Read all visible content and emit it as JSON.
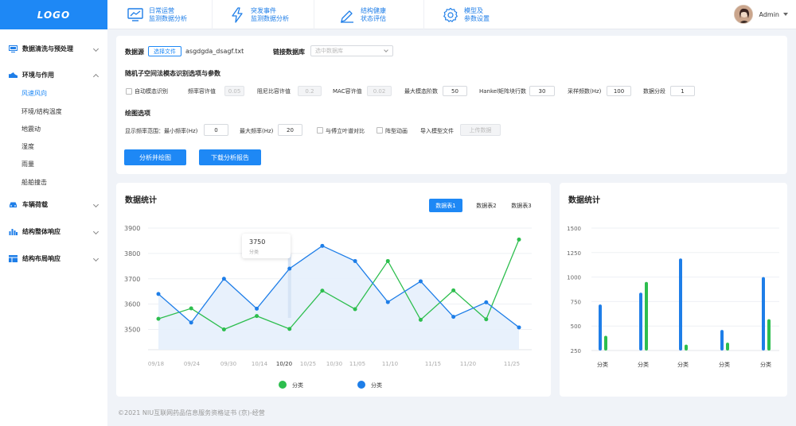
{
  "logo": "LOGO",
  "top_nav": [
    {
      "label": "日常运营\n监测数据分析",
      "icon": "monitor-chart-icon"
    },
    {
      "label": "突发事件\n监测数据分析",
      "icon": "lightning-icon"
    },
    {
      "label": "结构健康\n状态评估",
      "icon": "pen-edit-icon"
    },
    {
      "label": "模型及\n参数设置",
      "icon": "gear-icon"
    }
  ],
  "user": {
    "name": "Admin"
  },
  "sidebar": {
    "groups": [
      {
        "label": "数据清洗与预处理",
        "icon": "monitor-icon"
      },
      {
        "label": "环境与作用",
        "icon": "shoe-icon"
      },
      {
        "label": "车辆荷载",
        "icon": "car-icon"
      },
      {
        "label": "结构整体响应",
        "icon": "bar-chart-icon"
      },
      {
        "label": "结构布局响应",
        "icon": "table-layout-icon"
      }
    ],
    "sub_items": [
      "风速风向",
      "环境/结构温度",
      "地震动",
      "湿度",
      "雨量",
      "船舶撞击"
    ],
    "active_sub": "风速风向"
  },
  "form": {
    "datasource_label": "数据源",
    "choose_file": "选择文件",
    "file_name": "asgdgda_dsagf.txt",
    "link_db_label": "链接数据库",
    "db_placeholder": "选中数据库",
    "section1_title": "随机子空间法模态识别选项与参数",
    "auto_modal": "自动模态识别",
    "freq_tol_label": "频率容许值",
    "freq_tol": "0.05",
    "damp_tol_label": "阻尼比容许值",
    "damp_tol": "0.2",
    "mac_tol_label": "MAC容许值",
    "mac_tol": "0.02",
    "max_order_label": "最大模态阶数",
    "max_order": "50",
    "hankel_label": "Hankel矩阵块行数",
    "hankel": "30",
    "sample_label": "采样频数(Hz)",
    "sample": "100",
    "segments_label": "数据分段",
    "segments": "1",
    "section2_title": "绘图选项",
    "freq_range_label": "显示频率范围：最小频率(Hz)",
    "min_freq": "0",
    "max_freq_label": "最大频率(Hz)",
    "max_freq": "20",
    "fourier_label": "与傅立叶谱对比",
    "mode_anim_label": "阵型动画",
    "import_model_label": "导入模型文件",
    "upload_label": "上传数据",
    "analyze_btn": "分析并绘图",
    "download_btn": "下载分析报告"
  },
  "line_card": {
    "title": "数据统计",
    "tabs": [
      "数据表1",
      "数据表2",
      "数据表3"
    ],
    "tooltip_value": "3750",
    "tooltip_label": "分类",
    "legend": [
      "分类",
      "分类"
    ],
    "colors": {
      "green": "#2dbe4e",
      "blue": "#1e7ee8"
    }
  },
  "bar_card": {
    "title": "数据统计"
  },
  "chart_data": [
    {
      "type": "line",
      "x": [
        "09/18",
        "09/24",
        "09/30",
        "10/14",
        "10/20",
        "10/25",
        "10/30",
        "11/05",
        "11/10",
        "11/15",
        "11/20",
        "11/25"
      ],
      "series": [
        {
          "name": "分类",
          "color": "#2dbe4e",
          "values": [
            3542,
            3583,
            3500,
            3553,
            3502,
            3653,
            3580,
            3770,
            3538,
            3654,
            3540,
            3855
          ]
        },
        {
          "name": "分类",
          "color": "#1e7ee8",
          "values": [
            3640,
            3527,
            3700,
            3582,
            3740,
            3830,
            3770,
            3608,
            3690,
            3550,
            3607,
            3508
          ]
        }
      ],
      "yticks": [
        3500,
        3600,
        3700,
        3800,
        3900
      ],
      "ylim": [
        3420,
        3900
      ]
    },
    {
      "type": "bar",
      "categories": [
        "分类",
        "分类",
        "分类",
        "分类",
        "分类"
      ],
      "series": [
        {
          "color": "#1e7ee8",
          "values": [
            720,
            840,
            1190,
            460,
            1000
          ]
        },
        {
          "color": "#2dbe4e",
          "values": [
            400,
            950,
            310,
            330,
            570
          ]
        }
      ],
      "yticks": [
        250,
        500,
        750,
        1000,
        1250,
        1500
      ],
      "ylim": [
        250,
        1500
      ]
    }
  ],
  "footer": "©2021 NIU互联网药品信息服务资格证书 (京)-经营"
}
